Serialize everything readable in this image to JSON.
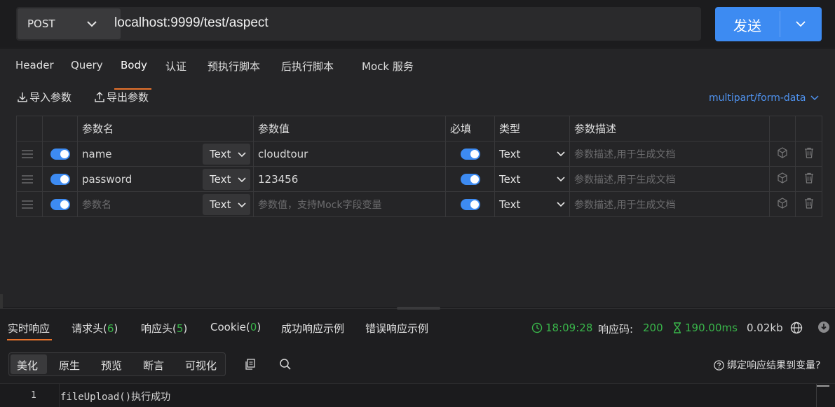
{
  "request": {
    "method": "POST",
    "url": "localhost:9999/test/aspect",
    "send_label": "发送"
  },
  "tabs": [
    {
      "label": "Header"
    },
    {
      "label": "Query"
    },
    {
      "label": "Body",
      "active": true
    },
    {
      "label": "认证"
    },
    {
      "label": "预执行脚本"
    },
    {
      "label": "后执行脚本"
    },
    {
      "label": "Mock 服务"
    }
  ],
  "actions": {
    "import_label": "导入参数",
    "export_label": "导出参数",
    "content_type": "multipart/form-data"
  },
  "table": {
    "headers": {
      "name": "参数名",
      "value": "参数值",
      "required": "必填",
      "type": "类型",
      "desc": "参数描述"
    },
    "rows": [
      {
        "enabled": true,
        "name": "name",
        "name_type": "Text",
        "value": "cloudtour",
        "required": true,
        "type": "Text",
        "desc": ""
      },
      {
        "enabled": true,
        "name": "password",
        "name_type": "Text",
        "value": "123456",
        "required": true,
        "type": "Text",
        "desc": ""
      },
      {
        "enabled": true,
        "name": "",
        "name_type": "Text",
        "value": "",
        "required": true,
        "type": "Text",
        "desc": ""
      }
    ],
    "placeholders": {
      "name": "参数名",
      "value": "参数值，支持Mock字段变量",
      "desc": "参数描述,用于生成文档"
    }
  },
  "response": {
    "tabs": {
      "realtime": "实时响应",
      "req_headers_label": "请求头(",
      "req_headers_count": "6",
      "resp_headers_label": "响应头(",
      "resp_headers_count": "5",
      "cookie_label": "Cookie(",
      "cookie_count": "0",
      "close_paren": ")",
      "success_example": "成功响应示例",
      "error_example": "错误响应示例"
    },
    "time": "18:09:28",
    "status_label": "响应码:",
    "status_code": "200",
    "duration": "190.00ms",
    "size": "0.02kb",
    "view_modes": [
      "美化",
      "原生",
      "预览",
      "断言",
      "可视化"
    ],
    "bind_label": "绑定响应结果到变量?",
    "code_lines": [
      {
        "num": "1",
        "text": "fileUpload()执行成功"
      }
    ]
  },
  "colors": {
    "accent": "#3d8bf2",
    "active_tab_underline": "#e8732c",
    "success": "#39b54a",
    "link": "#4f93f0"
  }
}
